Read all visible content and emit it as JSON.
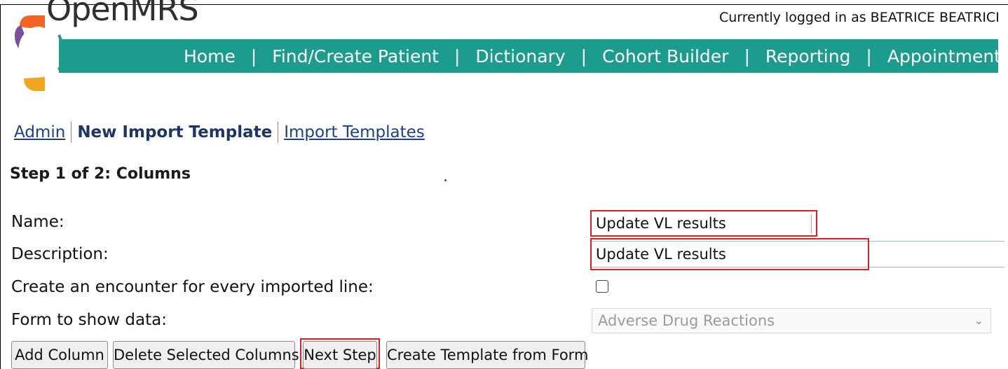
{
  "header": {
    "logo_text": "OpenMRS",
    "user_info": "Currently logged in as BEATRICE BEATRICE B"
  },
  "nav": {
    "items": [
      "Home",
      "Find/Create Patient",
      "Dictionary",
      "Cohort Builder",
      "Reporting",
      "Appointments"
    ]
  },
  "breadcrumb": {
    "admin": "Admin",
    "current": "New Import Template",
    "templates": "Import Templates"
  },
  "page": {
    "step_title": "Step 1 of 2: Columns"
  },
  "form": {
    "name_label": "Name:",
    "name_value": "Update VL results",
    "description_label": "Description:",
    "description_value": "Update VL results",
    "encounter_label": "Create an encounter for every imported line:",
    "encounter_checked": false,
    "form_label": "Form to show data:",
    "form_selected": "Adverse Drug Reactions"
  },
  "buttons": {
    "add_column": "Add Column",
    "delete_columns": "Delete Selected Columns",
    "next_step": "Next Step",
    "create_from_form": "Create Template from Form"
  },
  "colors": {
    "nav_bar": "#1c9c8c",
    "highlight": "#e02020",
    "link": "#1d3f8a"
  }
}
